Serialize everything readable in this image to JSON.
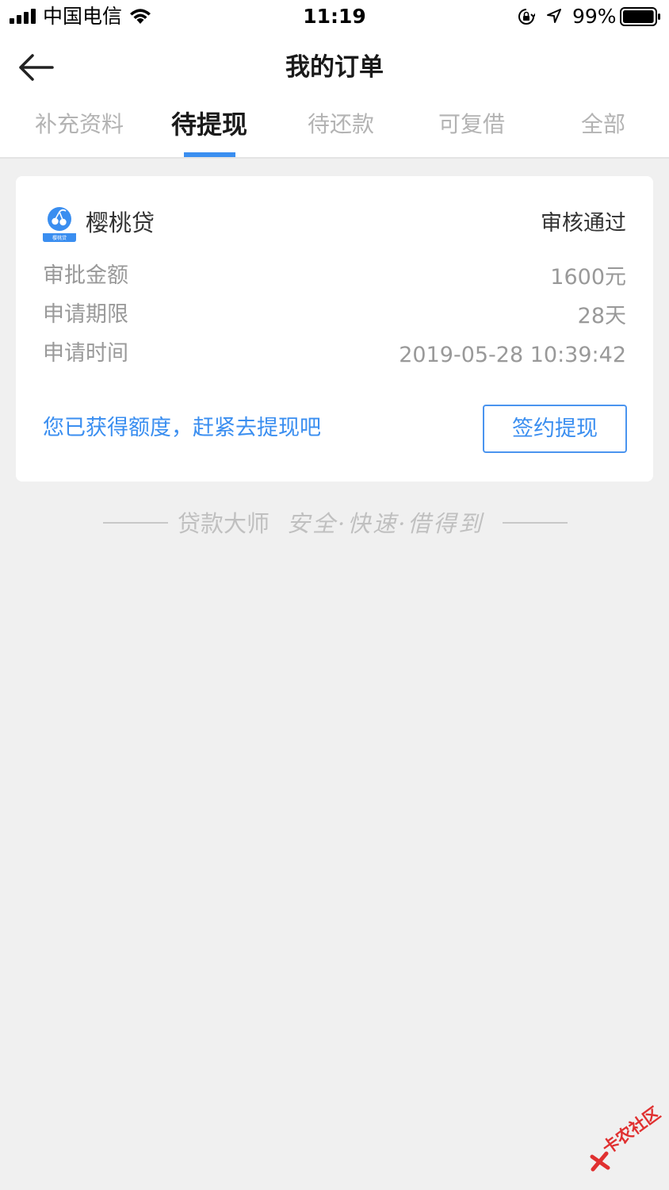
{
  "status_bar": {
    "carrier": "中国电信",
    "time": "11:19",
    "battery_percent": "99%",
    "battery_level": 0.99,
    "icons": [
      "signal-icon",
      "wifi-icon",
      "orientation-lock-icon",
      "location-icon",
      "battery-icon"
    ]
  },
  "nav": {
    "title": "我的订单",
    "back_icon": "back-arrow-icon"
  },
  "tabs": [
    {
      "label": "补充资料",
      "active": false
    },
    {
      "label": "待提现",
      "active": true
    },
    {
      "label": "待还款",
      "active": false
    },
    {
      "label": "可复借",
      "active": false
    },
    {
      "label": "全部",
      "active": false
    }
  ],
  "colors": {
    "accent": "#3a8ef0",
    "background": "#f0f0f0",
    "card": "#ffffff",
    "muted_text": "#999999",
    "dark_text": "#333333"
  },
  "order": {
    "logo_icon": "cherry-logo-icon",
    "logo_caption": "樱桃贷",
    "product_name": "樱桃贷",
    "status": "审核通过",
    "rows": [
      {
        "label": "审批金额",
        "value": "1600元"
      },
      {
        "label": "申请期限",
        "value": "28天"
      },
      {
        "label": "申请时间",
        "value": "2019-05-28 10:39:42"
      }
    ],
    "promo_text": "您已获得额度，赶紧去提现吧",
    "action_label": "签约提现"
  },
  "footer": {
    "brand": "贷款大师",
    "slogan": "安全·快速·借得到"
  },
  "watermark": {
    "text": "卡农社区"
  }
}
